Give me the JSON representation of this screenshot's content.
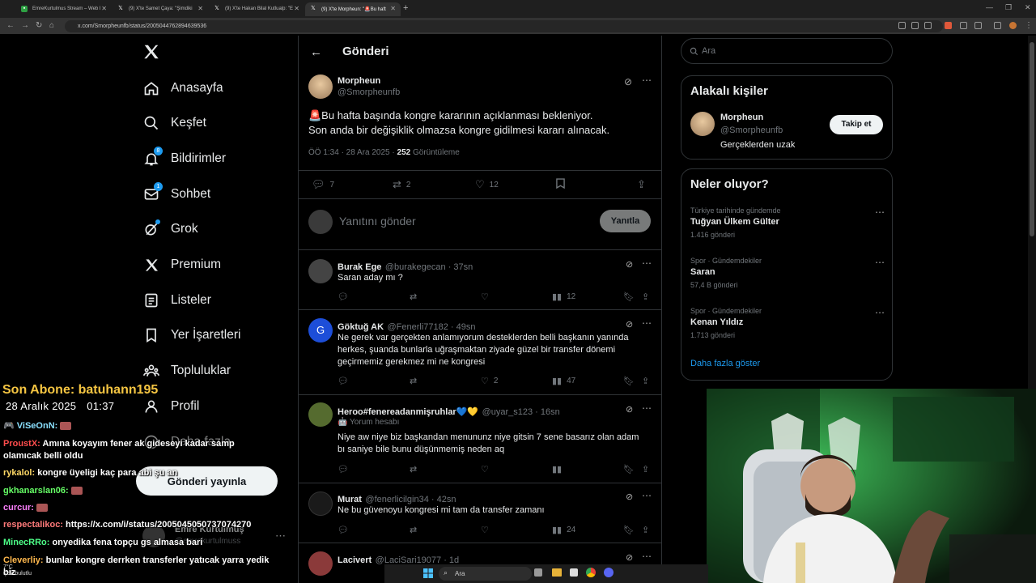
{
  "browser": {
    "tabs": [
      {
        "label": "EmreKurtulmus Stream – Web I",
        "favicon_color": "#2ea043"
      },
      {
        "label": "(9) X'te Samet Çaya: \"Şimdiki ",
        "favicon_color": "#ffffff"
      },
      {
        "label": "(9) X'te Hakan Bilal Kutlualp: \"E",
        "favicon_color": "#ffffff"
      },
      {
        "label": "(9) X'te Morpheun: \"🚨Bu haft",
        "favicon_color": "#ffffff"
      }
    ],
    "url": "x.com/Smorpheunfb/status/2005044762894639536"
  },
  "nav": {
    "items": [
      {
        "label": "Anasayfa",
        "icon": "home-icon"
      },
      {
        "label": "Keşfet",
        "icon": "search-icon"
      },
      {
        "label": "Bildirimler",
        "icon": "bell-icon",
        "badge": "8"
      },
      {
        "label": "Sohbet",
        "icon": "mail-icon",
        "badge": "1"
      },
      {
        "label": "Grok",
        "icon": "grok-icon"
      },
      {
        "label": "Premium",
        "icon": "x-logo-icon"
      },
      {
        "label": "Listeler",
        "icon": "list-icon"
      },
      {
        "label": "Yer İşaretleri",
        "icon": "bookmark-icon"
      },
      {
        "label": "Topluluklar",
        "icon": "people-icon"
      },
      {
        "label": "Profil",
        "icon": "person-icon"
      },
      {
        "label": "Daha fazla",
        "icon": "more-circle-icon"
      }
    ],
    "post_button": "Gönderi yayınla",
    "account": {
      "name": "Emre Kurtulmuş",
      "handle": "@emrekurtulmuss"
    }
  },
  "stream_overlay": {
    "last_subscriber": "Son Abone: batuhann195",
    "date": "28 Aralık 2025",
    "time": "01:37",
    "chat": [
      {
        "user": "ViSeOnN:",
        "msg": "",
        "color": "#8ae0ff",
        "emote": true
      },
      {
        "user": "ProustX:",
        "msg": "Amına koyayım fener ak gideseyi kadar samp olamıcak belli oldu",
        "color": "#ff4d4d"
      },
      {
        "user": "rykalol:",
        "msg": "kongre üyeligi kaç para abi şu an",
        "color": "#ffd966"
      },
      {
        "user": "gkhanarslan06:",
        "msg": "",
        "color": "#66ff66",
        "emote": true
      },
      {
        "user": "curcur:",
        "msg": "",
        "color": "#ff80ff",
        "emote": true
      },
      {
        "user": "respectalikoc:",
        "msg": "https://x.com/i/status/2005045050737074270",
        "color": "#ff7a7a"
      },
      {
        "user": "MinecRRo:",
        "msg": "onyedika fena topçu gs almasa bari",
        "color": "#4dff88"
      },
      {
        "user": "Cleverliy:",
        "msg": "bunlar kongre derrken transferler yatıcak yarra yedik biz",
        "color": "#ffb84d"
      }
    ]
  },
  "header": {
    "title": "Gönderi"
  },
  "tweet": {
    "author": "Morpheun",
    "handle": "@Smorpheunfb",
    "line1": "🚨Bu hafta başında kongre kararının açıklanması bekleniyor.",
    "line2": "Son anda bir değişiklik olmazsa kongre gidilmesi kararı alınacak.",
    "time": "ÖÖ 1:34 · 28 Ara 2025 · ",
    "views_count": "252",
    "views_label": " Görüntüleme",
    "replies": "7",
    "reposts": "2",
    "likes": "12"
  },
  "reply_box": {
    "placeholder": "Yanıtını gönder",
    "button": "Yanıtla"
  },
  "replies": [
    {
      "name": "Burak Ege",
      "meta": "@burakegecan · 37sn",
      "body": [
        "Saran aday mı ?"
      ],
      "likes": "",
      "reposts": "",
      "views": "12",
      "avatar": "#444"
    },
    {
      "name": "Göktuğ AK",
      "meta": "@Fenerli77182 · 49sn",
      "body": [
        "Ne gerek var gerçekten anlamıyorum desteklerden belli başkanın yanında",
        "herkes, şuanda bunlarla uğraşmaktan ziyade güzel bir transfer dönemi",
        "geçirmemiz gerekmez mi ne kongresi"
      ],
      "likes": "2",
      "reposts": "",
      "views": "47",
      "avatar": "#1d4ed8",
      "initial": "G"
    },
    {
      "name": "Heroo#fenereadanmişruhlar💙💛",
      "meta": "@uyar_s123 · 16sn",
      "tag": "🤖 Yorum hesabı",
      "body": [
        "Niye aw niye biz başkandan menununz niye gitsin 7 sene basarız olan adam",
        "bı saniye bile bunu düşünmemiş neden aq"
      ],
      "likes": "",
      "reposts": "",
      "views": "",
      "avatar": "#556b2f"
    },
    {
      "name": "Murat",
      "meta": "@fenerlicilgin34 · 42sn",
      "body": [
        "Ne bu güvenoyu kongresi mi tam da transfer zamanı"
      ],
      "likes": "",
      "reposts": "",
      "views": "24",
      "avatar": "#222"
    },
    {
      "name": "Lacivert",
      "meta": "@LaciSari19077 · 1d",
      "body": [],
      "likes": "",
      "reposts": "",
      "views": "",
      "avatar": "#8b3a3a"
    }
  ],
  "search": {
    "placeholder": "Ara"
  },
  "related": {
    "title": "Alakalı kişiler",
    "name": "Morpheun",
    "handle": "@Smorpheunfb",
    "bio": "Gerçeklerden uzak",
    "follow": "Takip et"
  },
  "trends": {
    "title": "Neler oluyor?",
    "items": [
      {
        "cat": "Türkiye tarihinde gündemde",
        "name": "Tuğyan Ülkem Gülter",
        "count": "1.416 gönderi"
      },
      {
        "cat": "Spor · Gündemdekiler",
        "name": "Saran",
        "count": "57,4 B gönderi"
      },
      {
        "cat": "Spor · Gündemdekiler",
        "name": "Kenan Yıldız",
        "count": "1.713 gönderi"
      }
    ],
    "more": "Daha fazla göster"
  },
  "taskbar": {
    "search": "Ara",
    "weather_temp": "7°C",
    "weather_desc": "Çok bulutlu"
  }
}
